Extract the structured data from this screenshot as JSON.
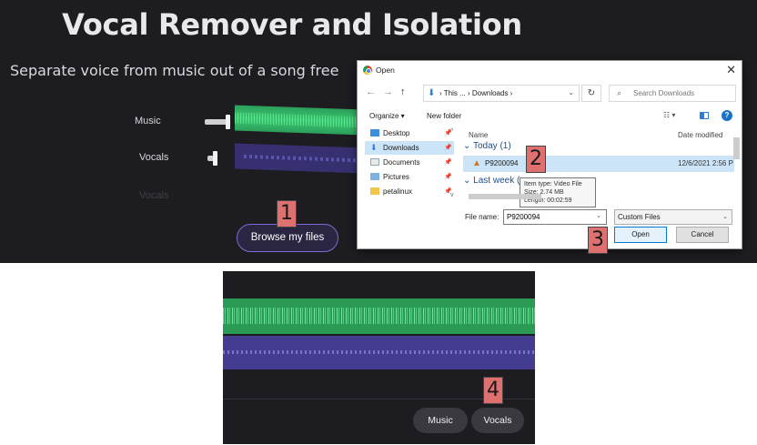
{
  "hero": {
    "title": "Vocal Remover and Isolation",
    "subtitle": "Separate voice from music out of a song free"
  },
  "mixer": {
    "tracks": [
      "Music",
      "Vocals",
      "Vocals"
    ]
  },
  "browse_button": "Browse my files",
  "dialog": {
    "title": "Open",
    "close": "✕",
    "path": [
      "This ...",
      "Downloads"
    ],
    "search_placeholder": "Search Downloads",
    "toolbar": {
      "organize": "Organize ▾",
      "new_folder": "New folder"
    },
    "nav_items": [
      "Desktop",
      "Downloads",
      "Documents",
      "Pictures",
      "petalinux"
    ],
    "columns": {
      "name": "Name",
      "date": "Date modified"
    },
    "groups": [
      "Today (1)",
      "Last week ("
    ],
    "file": {
      "name": "P9200094",
      "date": "12/6/2021 2:56 P"
    },
    "tooltip": {
      "type": "Item type: Video File",
      "size": "Size: 2.74 MB",
      "length": "Length: 00:02:59"
    },
    "file_name_label": "File name:",
    "file_name_value": "P9200094",
    "file_type": "Custom Files",
    "open": "Open",
    "cancel": "Cancel"
  },
  "steps": [
    "1",
    "2",
    "3",
    "4"
  ],
  "bottom_tabs": {
    "music": "Music",
    "vocals": "Vocals"
  },
  "colors": {
    "background": "#1d1c21",
    "music_wave": "#2a9a55",
    "vocals_wave": "#433c91",
    "step_label": "#de7070",
    "accent": "#7a6ed6"
  }
}
